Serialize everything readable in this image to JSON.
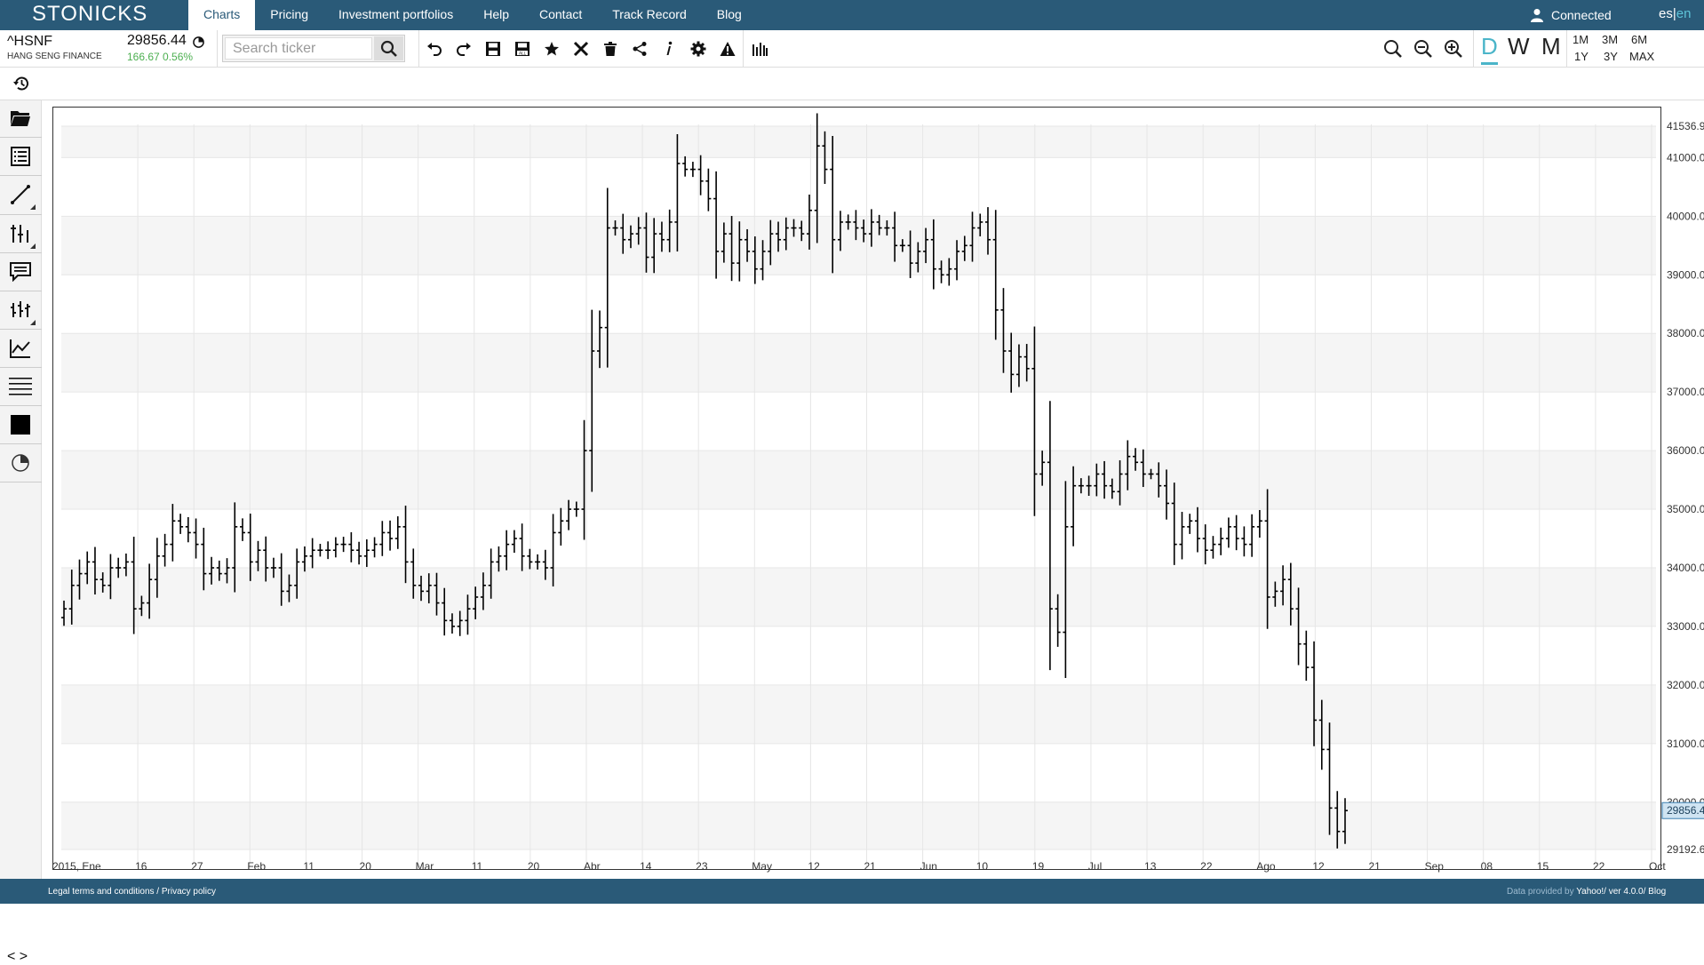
{
  "app": {
    "logo": "STONICKS"
  },
  "nav": {
    "links": [
      {
        "label": "Charts",
        "active": true
      },
      {
        "label": "Pricing"
      },
      {
        "label": "Investment portfolios"
      },
      {
        "label": "Help"
      },
      {
        "label": "Contact"
      },
      {
        "label": "Track Record"
      },
      {
        "label": "Blog"
      }
    ],
    "status": "Connected",
    "lang_es": "es",
    "lang_sep": "|",
    "lang_en": "en"
  },
  "ticker": {
    "symbol": "^HSNF",
    "name": "HANG SENG FINANCE",
    "price": "29856.44",
    "change": "166.67 0.56%"
  },
  "search": {
    "placeholder": "Search ticker"
  },
  "toolbar": {
    "icons": [
      "undo-icon",
      "redo-icon",
      "save-icon",
      "save-all-icon",
      "star-icon",
      "close-icon",
      "trash-icon",
      "share-icon",
      "info-icon",
      "settings-icon",
      "warning-icon",
      "volume-bars-icon"
    ],
    "zoom_icons": [
      "search-icon",
      "zoom-out-icon",
      "zoom-in-icon"
    ],
    "periods": [
      "D",
      "W",
      "M"
    ],
    "active_period": "D",
    "ranges_top": [
      "1M",
      "3M",
      "6M"
    ],
    "ranges_bottom": [
      "1Y",
      "3Y",
      "MAX"
    ]
  },
  "sidebar": {
    "tools": [
      "folder-icon",
      "list-icon",
      "line-tool-icon",
      "fork-tool-icon",
      "comment-icon",
      "bars-tool-icon",
      "indicator-icon",
      "horizontal-lines-icon",
      "color-square-icon",
      "pie-icon"
    ],
    "nav": "< >"
  },
  "chart_data": {
    "type": "ohlc",
    "ticker": "^HSNF",
    "y_ticks": [
      "41000.00",
      "40000.00",
      "39000.00",
      "38000.00",
      "37000.00",
      "36000.00",
      "35000.00",
      "34000.00",
      "33000.00",
      "32000.00",
      "31000.00",
      "30000.00"
    ],
    "y_top_label": "41536.94",
    "y_bottom_label": "29192.62",
    "last_price_label": "29856.44",
    "ylim": [
      29192.62,
      41536.94
    ],
    "x_labels": [
      "2015, Ene",
      "16",
      "27",
      "Feb",
      "11",
      "20",
      "Mar",
      "11",
      "20",
      "Abr",
      "14",
      "23",
      "May",
      "12",
      "21",
      "Jun",
      "10",
      "19",
      "Jul",
      "13",
      "22",
      "Ago",
      "12",
      "21",
      "Sep",
      "08",
      "15",
      "22",
      "Oct"
    ],
    "closes": [
      33300,
      33700,
      33900,
      34100,
      33800,
      33700,
      34000,
      34000,
      34100,
      33300,
      33400,
      33800,
      34200,
      34400,
      34800,
      34700,
      34600,
      34400,
      33900,
      34000,
      33900,
      34000,
      34700,
      34600,
      34100,
      34300,
      34000,
      34000,
      33600,
      33700,
      34100,
      34200,
      34300,
      34300,
      34300,
      34400,
      34400,
      34300,
      34200,
      34300,
      34400,
      34600,
      34500,
      34700,
      34100,
      33700,
      33600,
      33700,
      33400,
      33100,
      33000,
      33100,
      33300,
      33500,
      33700,
      34100,
      34200,
      34400,
      34500,
      34200,
      34100,
      34100,
      34000,
      34600,
      34800,
      35000,
      35000,
      36000,
      37700,
      38100,
      39800,
      39800,
      39600,
      39700,
      39800,
      39300,
      39700,
      39600,
      39900,
      40900,
      40800,
      40800,
      40600,
      40300,
      39400,
      39700,
      39200,
      39600,
      39400,
      39100,
      39400,
      39700,
      39600,
      39800,
      39800,
      39700,
      40100,
      41200,
      40800,
      39600,
      39900,
      39900,
      39800,
      39700,
      39900,
      39800,
      39800,
      39500,
      39500,
      39200,
      39400,
      39600,
      39100,
      39000,
      39100,
      39400,
      39500,
      39800,
      39900,
      39600,
      38400,
      37700,
      37300,
      37600,
      37400,
      35600,
      35800,
      33300,
      32900,
      34700,
      35400,
      35400,
      35400,
      35600,
      35400,
      35300,
      35600,
      35900,
      35800,
      35600,
      35600,
      35400,
      35100,
      34400,
      34700,
      34800,
      34500,
      34300,
      34400,
      34500,
      34700,
      34500,
      34400,
      34700,
      34800,
      33500,
      33600,
      33800,
      33300,
      32700,
      32300,
      31400,
      30900,
      29900,
      29500,
      29856.44
    ]
  },
  "footer": {
    "legal": "Legal terms and conditions / Privacy policy",
    "provided_prefix": "Data provided by ",
    "provided_brand": "Yahoo!/ ver 4.0.0/ Blog"
  }
}
